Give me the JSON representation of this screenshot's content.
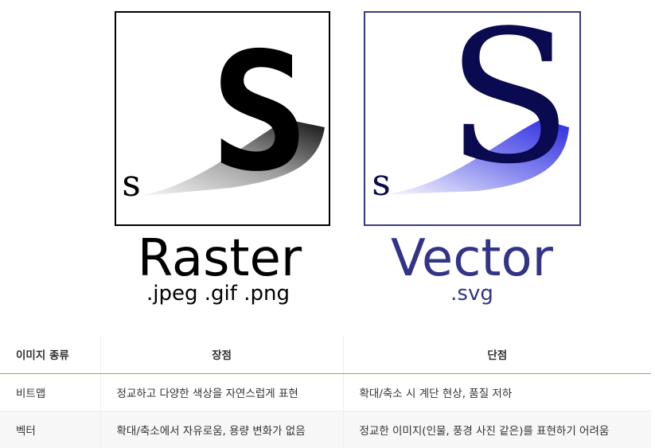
{
  "figure": {
    "raster": {
      "big_letter": "S",
      "small_letter": "s",
      "title": "Raster",
      "formats": ".jpeg .gif .png"
    },
    "vector": {
      "big_letter": "S",
      "small_letter": "s",
      "title": "Vector",
      "formats": ".svg"
    },
    "colors": {
      "raster_text": "#000000",
      "vector_text": "#333388",
      "vector_letter": "#0a0a50",
      "vector_frame": "#3a3a7a"
    }
  },
  "table": {
    "headers": [
      "이미지 종류",
      "장점",
      "단점"
    ],
    "rows": [
      [
        "비트맵",
        "정교하고 다양한 색상을 자연스럽게 표현",
        "확대/축소 시 계단 현상, 품질 저하"
      ],
      [
        "벡터",
        "확대/축소에서 자유로움, 용량 변화가 없음",
        "정교한 이미지(인물, 풍경 사진 같은)를 표현하기 어려움"
      ]
    ],
    "header_border_color": "#e08a2c"
  }
}
